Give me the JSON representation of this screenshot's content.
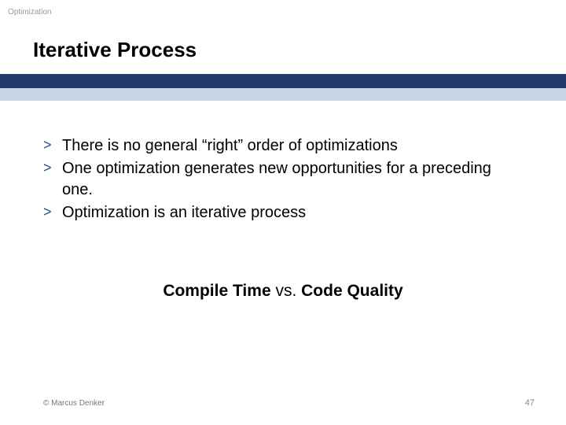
{
  "header": {
    "topic": "Optimization",
    "title": "Iterative Process"
  },
  "bullets": {
    "marker": ">",
    "items": [
      "There is no general “right” order of optimizations",
      "One optimization generates new opportunities for a preceding one.",
      "Optimization is an iterative process"
    ]
  },
  "comparison": {
    "left": "Compile Time",
    "mid": "  vs.  ",
    "right": "Code Quality"
  },
  "footer": {
    "copyright": "© Marcus Denker",
    "page": "47"
  }
}
